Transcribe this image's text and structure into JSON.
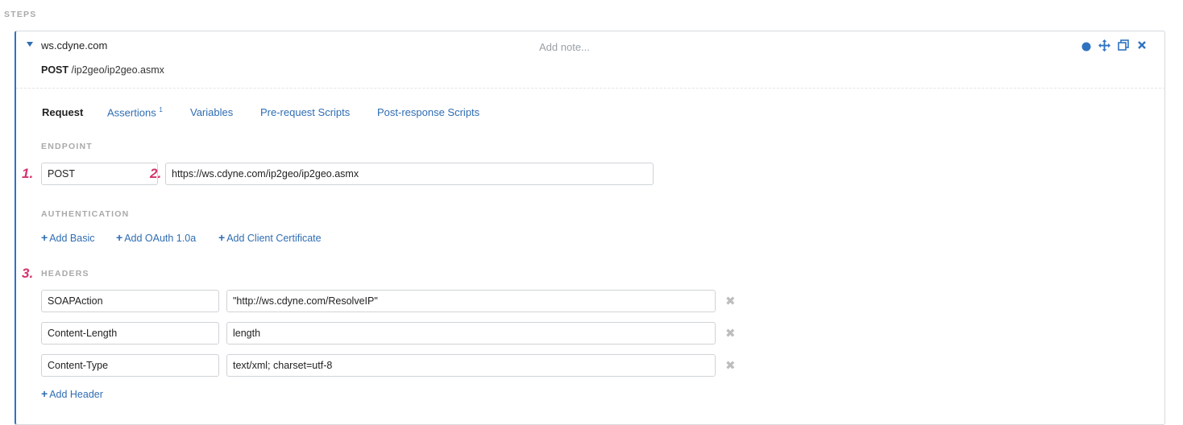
{
  "steps_label": "STEPS",
  "step": {
    "host": "ws.cdyne.com",
    "method": "POST",
    "path": "/ip2geo/ip2geo.asmx",
    "note_placeholder": "Add note..."
  },
  "tabs": [
    {
      "label": "Request",
      "active": true
    },
    {
      "label": "Assertions",
      "badge": "1"
    },
    {
      "label": "Variables"
    },
    {
      "label": "Pre-request Scripts"
    },
    {
      "label": "Post-response Scripts"
    }
  ],
  "endpoint": {
    "label": "ENDPOINT",
    "method": "POST",
    "url": "https://ws.cdyne.com/ip2geo/ip2geo.asmx"
  },
  "authentication": {
    "label": "AUTHENTICATION",
    "links": [
      "Add Basic",
      "Add OAuth 1.0a",
      "Add Client Certificate"
    ]
  },
  "headers": {
    "label": "HEADERS",
    "rows": [
      {
        "name": "SOAPAction",
        "value": "\"http://ws.cdyne.com/ResolveIP\""
      },
      {
        "name": "Content-Length",
        "value": "length"
      },
      {
        "name": "Content-Type",
        "value": "text/xml; charset=utf-8"
      }
    ],
    "add_label": "Add Header"
  },
  "markers": [
    "1.",
    "2.",
    "3."
  ],
  "icons": {
    "status": "circle-dot-icon",
    "move": "move-arrows-icon",
    "duplicate": "duplicate-icon",
    "close": "close-icon",
    "expand": "caret-down-icon",
    "delete": "remove-x-icon",
    "plus": "plus-icon"
  },
  "colors": {
    "accent": "#2f73c0",
    "marker": "#d6336c"
  }
}
